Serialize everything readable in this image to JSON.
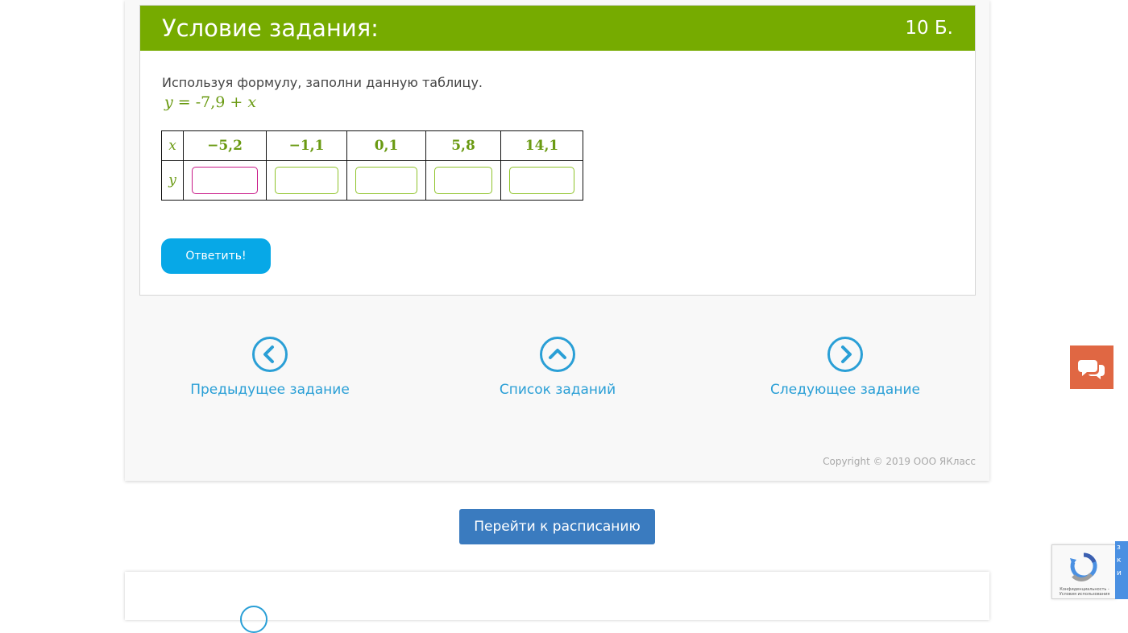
{
  "task": {
    "title": "Условие задания:",
    "points": "10 Б.",
    "instruction": "Используя формулу, заполни данную таблицу.",
    "formula": {
      "lhs": "y",
      "eq": " = ",
      "num": "-7,9",
      "plus": " + ",
      "rhs": "x"
    },
    "table": {
      "row_x_label": "x",
      "row_y_label": "y",
      "x_values": [
        "−5,2",
        "−1,1",
        "0,1",
        "5,8",
        "14,1"
      ],
      "y_inputs": [
        "",
        "",
        "",
        "",
        ""
      ]
    },
    "submit_label": "Ответить!"
  },
  "nav": {
    "prev": "Предыдущее задание",
    "list": "Список заданий",
    "next": "Следующее задание"
  },
  "copyright": "Copyright © 2019 ООО ЯКласс",
  "schedule_label": "Перейти к расписанию",
  "captcha": {
    "text": "Конфиденциальность - Условия использования",
    "side_letters": [
      "з",
      "к",
      "и"
    ]
  },
  "colors": {
    "header_green": "#76ab00",
    "accent_blue": "#07a8e7",
    "link_blue": "#2a9fd6",
    "schedule_blue": "#3a7bbf",
    "chat_orange": "#e06743",
    "active_input_border": "#c81887"
  }
}
